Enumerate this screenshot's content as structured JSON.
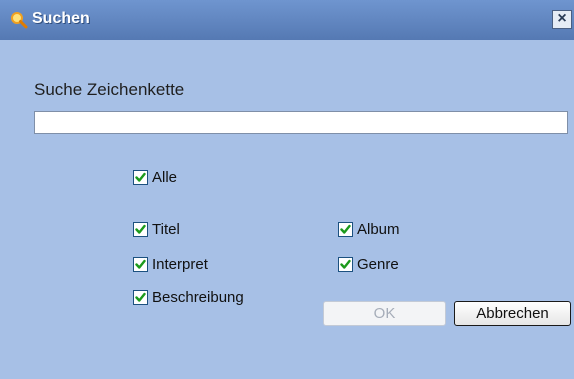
{
  "window": {
    "title": "Suchen",
    "icon": "search-icon",
    "close_glyph": "×"
  },
  "search": {
    "label": "Suche Zeichenkette",
    "value": "",
    "placeholder": ""
  },
  "checkboxes": {
    "alle": {
      "label": "Alle",
      "checked": true
    },
    "titel": {
      "label": "Titel",
      "checked": true
    },
    "album": {
      "label": "Album",
      "checked": true
    },
    "interpret": {
      "label": "Interpret",
      "checked": true
    },
    "genre": {
      "label": "Genre",
      "checked": true
    },
    "beschreibung": {
      "label": "Beschreibung",
      "checked": true
    }
  },
  "buttons": {
    "ok": {
      "label": "OK",
      "enabled": false
    },
    "cancel": {
      "label": "Abbrechen",
      "enabled": true
    }
  },
  "colors": {
    "titlebar": "#5c80bb",
    "body": "#a7c0e6",
    "checkmark": "#1c9a1c"
  }
}
